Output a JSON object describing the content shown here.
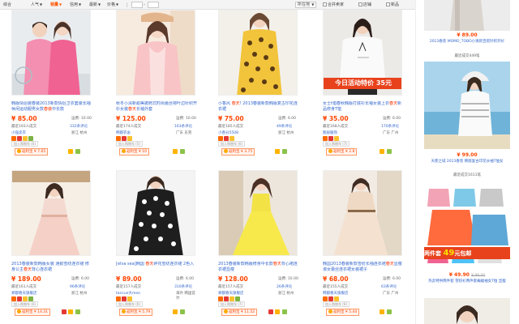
{
  "toolbar": {
    "items": [
      "综合",
      "人气",
      "销量",
      "信用",
      "最新",
      "价格"
    ],
    "page_to": "-",
    "location_label": "所在地",
    "checks": [
      "合并卖家",
      "店铺",
      "新品"
    ]
  },
  "products": [
    {
      "title_pre": "韩版情侣装春装2013新款情侣卫衣套装长袖休闲运动服男女款",
      "title_hl": "春装",
      "title_post": "中长款",
      "price": "¥ 85.00",
      "ship": "运费: 10.00",
      "sold": "最近193人成交",
      "reviews": "332条评论",
      "seller": "小强卖衣",
      "location": "浙江 杭州",
      "svc": "加入购物车 (6)",
      "wangbao": "返利宝 ¥ 7.65"
    },
    {
      "title_pre": "秋冬小清新甜美披肩式时尚蕾丝荷叶边针织开衫女装",
      "title_hl": "春天",
      "title_post": "长袖外套",
      "price": "¥ 125.00",
      "ship": "运费: 10.00",
      "sold": "最近174人成交",
      "reviews": "163条评论",
      "seller": "韩都衣舍",
      "location": "广东 东莞",
      "svc": "加入购物车 (5)",
      "wangbao": "返利宝 ¥ 10"
    },
    {
      "title_pre": "小香风 ",
      "title_hl": "春天",
      "title_post": "! 2013春装新款韩版复古印花连衣裙",
      "price": "¥ 75.00",
      "ship": "运费: 6.00",
      "sold": "最近185人成交",
      "reviews": "49条评论",
      "seller": "小香分5508",
      "location": "浙江 杭州",
      "svc": "加入购物车 (6)",
      "wangbao": "返利宝 ¥ 3.75"
    },
    {
      "title_pre": "女士t恤春秋韩版打底衫长袖女装上衣",
      "title_hl": "春天",
      "title_post": "新品修身T恤",
      "price": "¥ 35.00",
      "ship": "运费: 6.00",
      "sold": "最近168人成交",
      "reviews": "170条评论",
      "seller": "图居服饰",
      "location": "广东 广州",
      "svc": "加入购物车 (7)",
      "wangbao": "返利宝 ¥ 2.8"
    },
    {
      "title_pre": "2013春装新款韩版女装 通勤雪纺连衣裙 修身公主",
      "title_hl": "春天",
      "title_post": "背心连衣裙",
      "price": "¥ 189.00",
      "ship": "运费: 6.00",
      "sold": "最近161人成交",
      "reviews": "96条评论",
      "seller": "郑都春天旗舰店",
      "location": "浙江 杭州",
      "svc": "加入购物车 (6)",
      "wangbao": "返利宝 ¥ 14.31"
    },
    {
      "title_pre": "[elva sea]韩国 ",
      "title_hl": "春天",
      "title_post": "碎花雪纺连衣裙 2色入",
      "price": "¥ 89.00",
      "ship": "运费: 6.00",
      "sold": "最近157人成交",
      "reviews": "310条评论",
      "seller": "tancue大meo",
      "location": "海外 韩国首尔",
      "svc": "加入购物车 (6)",
      "wangbao": "返利宝 ¥ 5.79"
    },
    {
      "title_pre": "2013春装新款韩版修身中长款",
      "title_hl": "春天",
      "title_post": "背心裙连衣裙显瘦",
      "price": "¥ 128.00",
      "ship": "运费: 10.00",
      "sold": "最近157人成交",
      "reviews": "26条评论",
      "seller": "郑都春天旗舰店",
      "location": "浙江 杭州",
      "svc": "加入购物车 (7)",
      "wangbao": "返利宝 ¥ 11.52"
    },
    {
      "title_pre": "韩国2013春装新款雪纺长袖连衣裙",
      "title_hl": "春天",
      "title_post": "显瘦淑女蕾丝连衣裙女装裙子",
      "price": "¥ 68.00",
      "ship": "运费: 6.00",
      "sold": "最近155人成交",
      "reviews": "63条评论",
      "seller": "韩都春天旗舰店",
      "location": "广东 广州",
      "svc": "加入购物车 (6)",
      "wangbao": "返利宝 ¥ 5.44"
    }
  ],
  "promo_text": "今日活动特价 35元",
  "sidebar": {
    "items": [
      {
        "price": "¥ 89.00",
        "title": "2013春装 MOMO_TOBO小清新百搭针织开衫",
        "sold": "最近成交449笔"
      },
      {
        "price": "¥ 99.00",
        "title": "天使之城 2013春装 韩版复古印花长袖T恤女",
        "sold": "最近成交1611笔"
      },
      {
        "price": "¥ 49.90",
        "old_price": "¥ 99.00",
        "title": "热卖特供两件套 雪纺衫两件套蝙蝠袖女T恤 显瘦",
        "sold": ""
      }
    ],
    "banner_pre": "两件套",
    "banner_num": "49",
    "banner_post": "元包邮"
  },
  "colors": {
    "accent": "#ff5500",
    "price": "#ff4400",
    "link": "#3366cc"
  }
}
